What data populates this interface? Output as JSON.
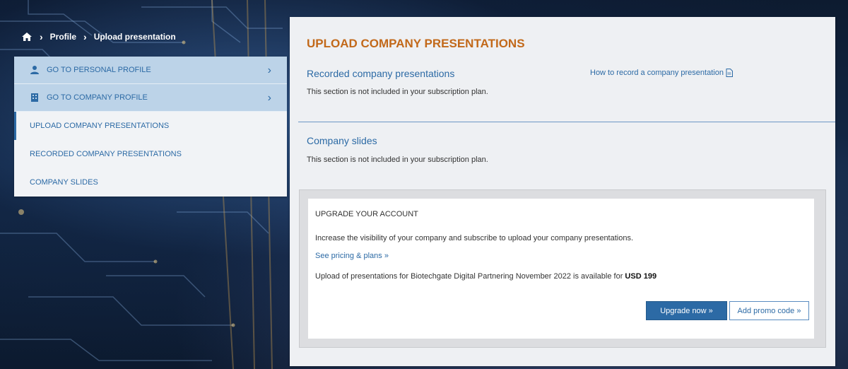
{
  "breadcrumb": {
    "home_icon": "home-icon",
    "separator": "›",
    "items": [
      "Profile",
      "Upload presentation"
    ]
  },
  "sidebar": {
    "links": [
      {
        "label": "GO TO PERSONAL PROFILE",
        "icon": "person-icon"
      },
      {
        "label": "GO TO COMPANY PROFILE",
        "icon": "building-icon"
      }
    ],
    "chevron": "›",
    "items": [
      {
        "label": "UPLOAD COMPANY PRESENTATIONS",
        "active": true
      },
      {
        "label": "RECORDED COMPANY PRESENTATIONS",
        "active": false
      },
      {
        "label": "COMPANY SLIDES",
        "active": false
      }
    ]
  },
  "main": {
    "title": "UPLOAD COMPANY PRESENTATIONS",
    "recorded": {
      "title": "Recorded company presentations",
      "note": "This section is not included in your subscription plan.",
      "help_link": "How to record a company presentation"
    },
    "slides": {
      "title": "Company slides",
      "note": "This section is not included in your subscription plan."
    },
    "upgrade": {
      "title": "UPGRADE YOUR ACCOUNT",
      "text": "Increase the visibility of your company and subscribe to upload your company presentations.",
      "link": "See pricing & plans »",
      "price_text": "Upload of presentations for Biotechgate Digital Partnering November 2022 is available for ",
      "price": "USD 199",
      "upgrade_button": "Upgrade now »",
      "promo_button": "Add promo code »"
    }
  },
  "colors": {
    "accent": "#2c6aa5",
    "title": "#c2691a",
    "sidebar_link_bg": "#bcd3e8",
    "panel_bg": "#eef0f3"
  }
}
